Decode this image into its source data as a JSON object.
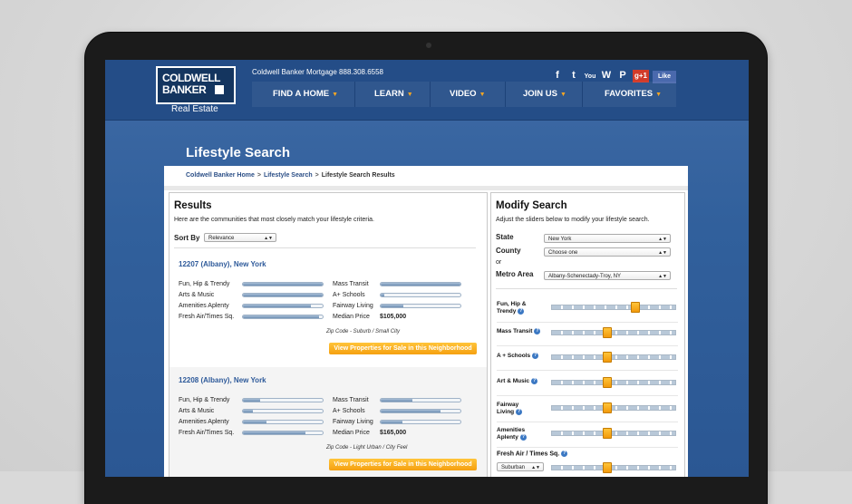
{
  "header": {
    "logo_line1": "COLDWELL",
    "logo_line2": "BANKER",
    "real_estate": "Real Estate",
    "phone": "Coldwell Banker Mortgage 888.308.6558",
    "social": {
      "facebook": "f",
      "twitter": "t",
      "youtube": "You",
      "wordpress": "W",
      "pinterest": "P",
      "gplus": "g+1",
      "fb_like": "Like"
    },
    "nav": [
      "FIND A HOME",
      "LEARN",
      "VIDEO",
      "JOIN US",
      "FAVORITES"
    ]
  },
  "page_title": "Lifestyle Search",
  "breadcrumb": [
    "Coldwell Banker Home",
    "Lifestyle Search",
    "Lifestyle Search Results"
  ],
  "results": {
    "title": "Results",
    "subtitle": "Here are the communities that most closely match your lifestyle criteria.",
    "sort_label": "Sort By",
    "sort_value": "Relevance",
    "communities": [
      {
        "title": "12207 (Albany), New York",
        "left_labels": [
          "Fun, Hip & Trendy",
          "Arts & Music",
          "Amenities Aplenty",
          "Fresh Air/Times Sq."
        ],
        "left_levels": [
          1.0,
          1.0,
          0.85,
          0.95
        ],
        "right_labels": [
          "Mass Transit",
          "A+ Schools",
          "Fairway Living",
          "Median Price"
        ],
        "right_levels": [
          1.0,
          0.05,
          0.28
        ],
        "median_price": "$105,000",
        "zip_note": "Zip Code - Suburb / Small City",
        "button": "View Properties for Sale in this Neighborhood"
      },
      {
        "title": "12208 (Albany), New York",
        "left_labels": [
          "Fun, Hip & Trendy",
          "Arts & Music",
          "Amenities Aplenty",
          "Fresh Air/Times Sq."
        ],
        "left_levels": [
          0.22,
          0.12,
          0.3,
          0.78
        ],
        "right_labels": [
          "Mass Transit",
          "A+ Schools",
          "Fairway Living",
          "Median Price"
        ],
        "right_levels": [
          0.4,
          0.75,
          0.27
        ],
        "median_price": "$165,000",
        "zip_note": "Zip Code - Light Urban / City Feel",
        "button": "View Properties for Sale in this Neighborhood"
      }
    ]
  },
  "modify": {
    "title": "Modify Search",
    "subtitle": "Adjust the sliders below to modify your lifestyle search.",
    "state_label": "State",
    "state_value": "New York",
    "county_label": "County",
    "county_value": "Choose one",
    "or": "or",
    "metro_label": "Metro Area",
    "metro_value": "Albany-Schenectady-Troy, NY",
    "sliders": [
      {
        "line1": "Fun, Hip &",
        "line2": "Trendy",
        "level": 0.67
      },
      {
        "line1": "Mass Transit",
        "line2": "",
        "level": 0.44
      },
      {
        "line1": "A + Schools",
        "line2": "",
        "level": 0.44
      },
      {
        "line1": "Art & Music",
        "line2": "",
        "level": 0.44
      },
      {
        "line1": "Fairway",
        "line2": "Living",
        "level": 0.44
      },
      {
        "line1": "Amenities",
        "line2": "Aplenty",
        "level": 0.44
      }
    ],
    "fresh_air_label": "Fresh Air / Times Sq.",
    "fresh_air_value": "Suburban",
    "fresh_air_level": 0.44
  }
}
